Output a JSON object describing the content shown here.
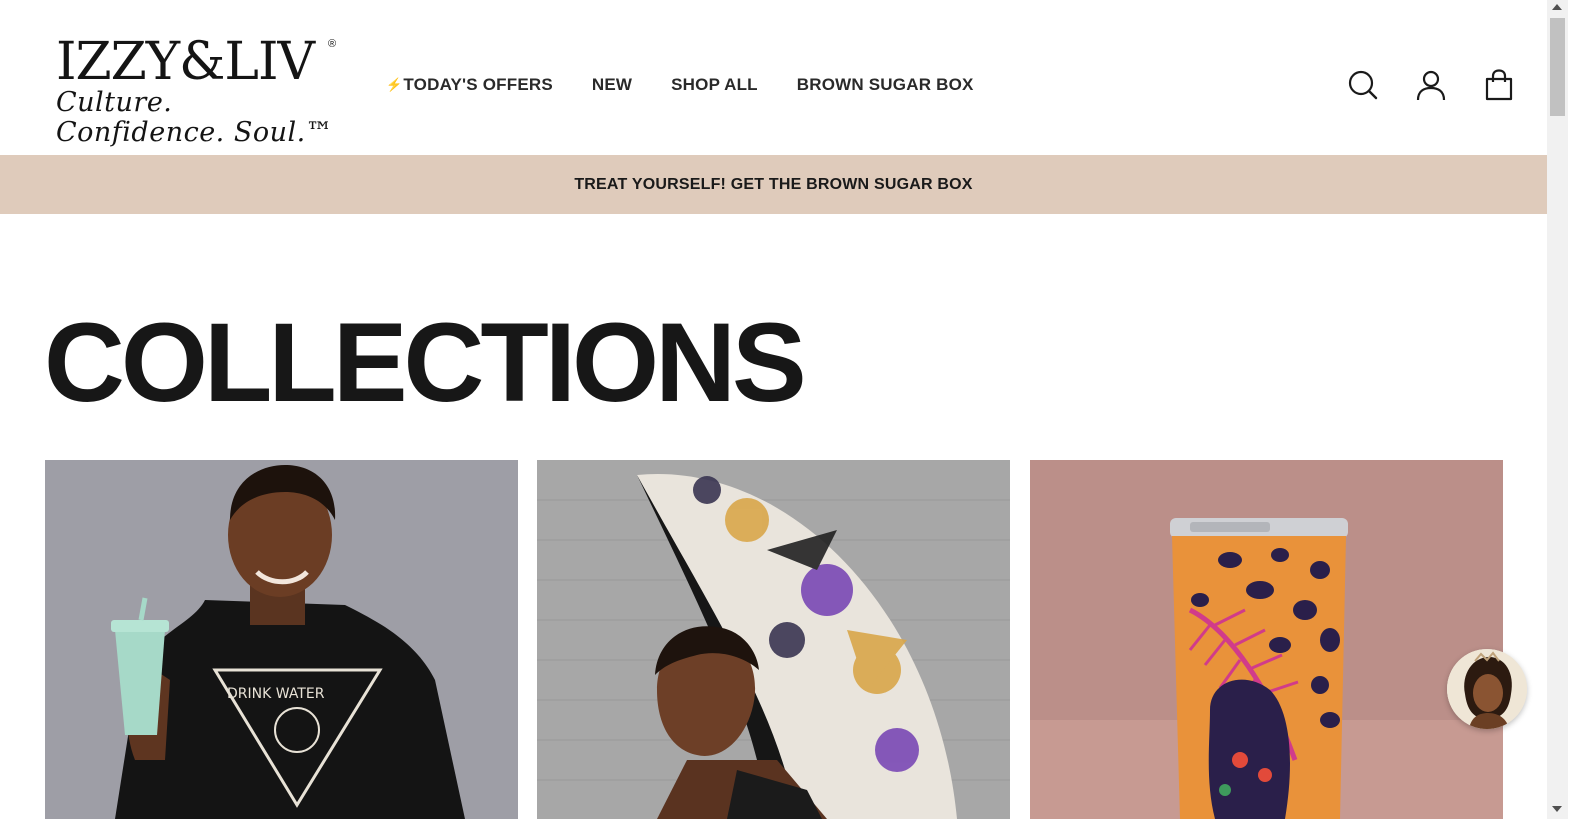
{
  "brand": {
    "logo_main": "IZZY&LIV",
    "logo_registered": "®",
    "logo_tagline": "Culture. Confidence. Soul.™"
  },
  "nav": {
    "items": [
      {
        "icon": "lightning-bolt",
        "label": "TODAY'S OFFERS"
      },
      {
        "label": "NEW"
      },
      {
        "label": "SHOP ALL"
      },
      {
        "label": "BROWN SUGAR BOX"
      }
    ]
  },
  "header_icons": [
    "search-icon",
    "account-icon",
    "cart-icon"
  ],
  "announcement": {
    "text": "TREAT YOURSELF! GET THE BROWN SUGAR BOX"
  },
  "page": {
    "title": "COLLECTIONS"
  },
  "collections": [
    {
      "image": "woman-in-drink-water-tshirt-holding-tumbler",
      "shirt_text": "DRINK WATER"
    },
    {
      "image": "woman-with-patterned-umbrella"
    },
    {
      "image": "patterned-tumbler"
    }
  ],
  "colors": {
    "announcement_bg": "#dfcbbb",
    "text": "#1a1a1a"
  }
}
